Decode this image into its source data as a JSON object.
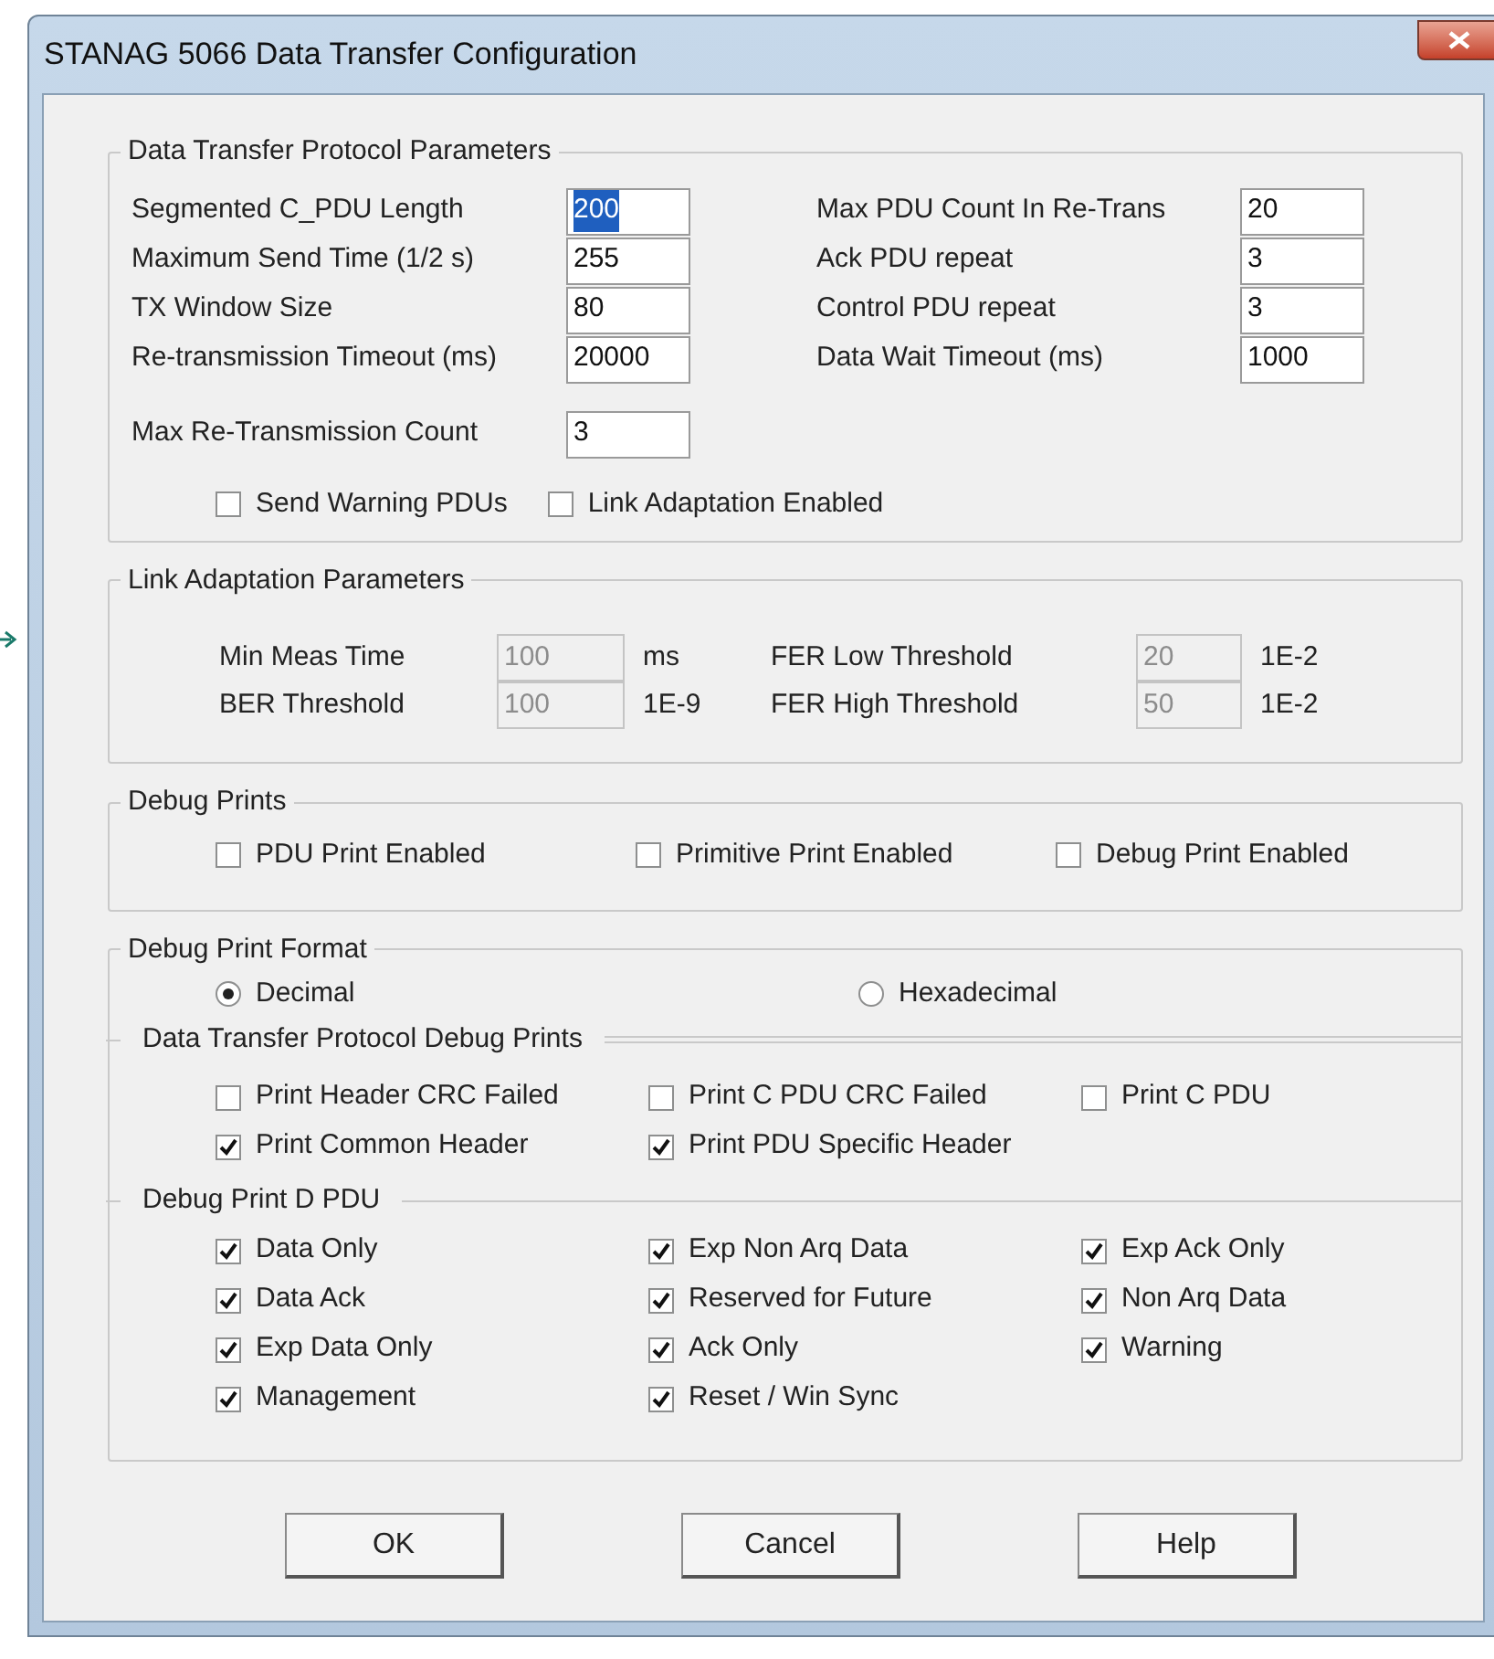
{
  "window": {
    "title": "STANAG 5066 Data Transfer Configuration"
  },
  "protocol_parameters": {
    "title": "Data Transfer Protocol Parameters",
    "left_fields": [
      {
        "label": "Segmented C_PDU Length",
        "value": "200",
        "text_selected": true
      },
      {
        "label": "Maximum Send Time (1/2 s)",
        "value": "255",
        "text_selected": false
      },
      {
        "label": "TX Window Size",
        "value": "80",
        "text_selected": false
      },
      {
        "label": "Re-transmission Timeout (ms)",
        "value": "20000",
        "text_selected": false
      },
      {
        "label": "Max Re-Transmission Count",
        "value": "3",
        "text_selected": false
      }
    ],
    "right_fields": [
      {
        "label": "Max PDU Count In Re-Trans",
        "value": "20",
        "text_selected": false
      },
      {
        "label": "Ack PDU repeat",
        "value": "3",
        "text_selected": false
      },
      {
        "label": "Control PDU repeat",
        "value": "3",
        "text_selected": false
      },
      {
        "label": "Data Wait Timeout (ms)",
        "value": "1000",
        "text_selected": false
      }
    ],
    "checkboxes": [
      {
        "label": "Send Warning PDUs",
        "checked": false
      },
      {
        "label": "Link Adaptation Enabled",
        "checked": false
      }
    ]
  },
  "link_adaptation": {
    "title": "Link Adaptation Parameters",
    "left_fields": [
      {
        "label": "Min Meas Time",
        "value": "100",
        "unit": "ms",
        "disabled": true
      },
      {
        "label": "BER Threshold",
        "value": "100",
        "unit": "1E-9",
        "disabled": true
      }
    ],
    "right_fields": [
      {
        "label": "FER Low Threshold",
        "value": "20",
        "unit": "1E-2",
        "disabled": true
      },
      {
        "label": "FER High Threshold",
        "value": "50",
        "unit": "1E-2",
        "disabled": true
      }
    ]
  },
  "debug_prints": {
    "title": "Debug Prints",
    "checkboxes": [
      {
        "label": "PDU Print Enabled",
        "checked": false
      },
      {
        "label": "Primitive Print Enabled",
        "checked": false
      },
      {
        "label": "Debug Print Enabled",
        "checked": false
      }
    ]
  },
  "debug_print_format": {
    "title": "Debug Print Format",
    "radios": [
      {
        "label": "Decimal",
        "selected": true
      },
      {
        "label": "Hexadecimal",
        "selected": false
      }
    ]
  },
  "protocol_debug_prints": {
    "title": "Data Transfer Protocol Debug Prints",
    "checkboxes": [
      {
        "label": "Print Header CRC Failed",
        "checked": false
      },
      {
        "label": "Print C PDU CRC Failed",
        "checked": false
      },
      {
        "label": "Print C PDU",
        "checked": false
      },
      {
        "label": "Print Common Header",
        "checked": true
      },
      {
        "label": "Print PDU Specific Header",
        "checked": true
      }
    ]
  },
  "debug_print_dpdu": {
    "title": "Debug Print D PDU",
    "checkboxes": [
      {
        "label": "Data Only",
        "checked": true
      },
      {
        "label": "Exp Non Arq Data",
        "checked": true
      },
      {
        "label": "Exp Ack Only",
        "checked": true
      },
      {
        "label": "Data Ack",
        "checked": true
      },
      {
        "label": "Reserved for Future",
        "checked": true
      },
      {
        "label": "Non Arq Data",
        "checked": true
      },
      {
        "label": "Exp Data Only",
        "checked": true
      },
      {
        "label": "Ack Only",
        "checked": true
      },
      {
        "label": "Warning",
        "checked": true
      },
      {
        "label": "Management",
        "checked": true
      },
      {
        "label": "Reset / Win Sync",
        "checked": true
      }
    ]
  },
  "buttons": [
    "OK",
    "Cancel",
    "Help"
  ]
}
